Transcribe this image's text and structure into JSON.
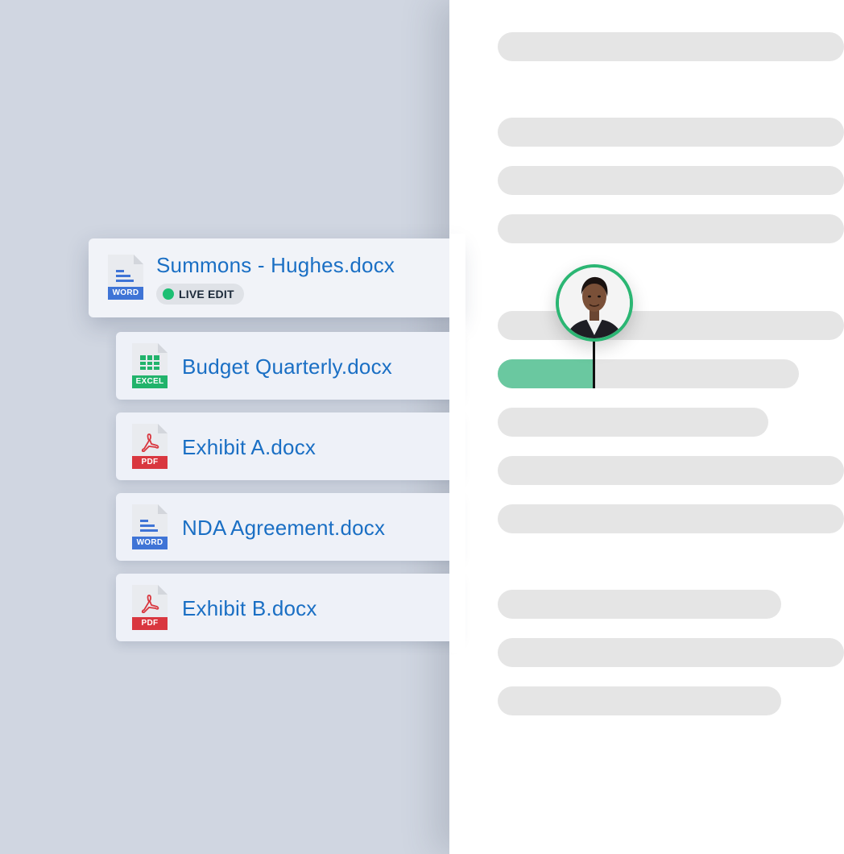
{
  "active_file": {
    "name": "Summons - Hughes.docx",
    "type_label": "WORD",
    "icon": "word-doc-icon",
    "badge": "LIVE EDIT"
  },
  "files": [
    {
      "name": "Budget Quarterly.docx",
      "type_label": "EXCEL",
      "icon": "excel-sheet-icon"
    },
    {
      "name": "Exhibit A.docx",
      "type_label": "PDF",
      "icon": "pdf-icon"
    },
    {
      "name": "NDA Agreement.docx",
      "type_label": "WORD",
      "icon": "word-doc-icon"
    },
    {
      "name": "Exhibit B.docx",
      "type_label": "PDF",
      "icon": "pdf-icon"
    }
  ],
  "document": {
    "editing_progress": 0.32
  },
  "colors": {
    "page_bg": "#d0d6e1",
    "file_name": "#1a6fc4",
    "word": "#3f74d6",
    "excel": "#21b36b",
    "pdf": "#d9373f",
    "live_dot": "#1dbf73",
    "edit_highlight": "#6ac8a0",
    "avatar_ring": "#2bb673"
  }
}
